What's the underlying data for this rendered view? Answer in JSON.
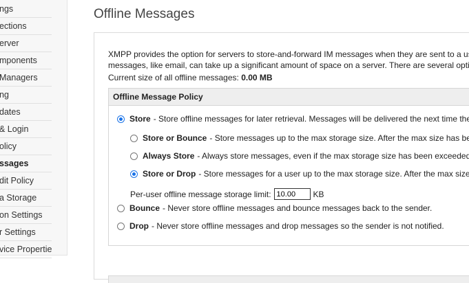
{
  "sidebar": {
    "items": [
      {
        "label": "ngs",
        "active": false
      },
      {
        "label": "ections",
        "active": false
      },
      {
        "label": "erver",
        "active": false
      },
      {
        "label": "mponents",
        "active": false
      },
      {
        "label": "Managers",
        "active": false
      },
      {
        "label": "ng",
        "active": false
      },
      {
        "label": "dates",
        "active": false
      },
      {
        "label": "& Login",
        "active": false
      },
      {
        "label": "olicy",
        "active": false
      },
      {
        "label": "ssages",
        "active": true
      },
      {
        "label": "dit Policy",
        "active": false
      },
      {
        "label": "a Storage",
        "active": false
      },
      {
        "label": "on Settings",
        "active": false
      },
      {
        "label": "r Settings",
        "active": false
      },
      {
        "label": "vice Properties",
        "active": false
      }
    ]
  },
  "main": {
    "title": "Offline Messages",
    "intro_line1": "XMPP provides the option for servers to store-and-forward IM messages when they are sent to a us",
    "intro_line2": "messages, like email, can take up a significant amount of space on a server. There are several opti",
    "current_size_label": "Current size of all offline messages:",
    "current_size_value": "0.00 MB",
    "policy": {
      "header": "Offline Message Policy",
      "store": {
        "label": "Store",
        "desc": "- Store offline messages for later retrieval. Messages will be delivered the next time the",
        "checked": true
      },
      "store_or_bounce": {
        "label": "Store or Bounce",
        "desc": "- Store messages up to the max storage size. After the max size has be",
        "checked": false
      },
      "always_store": {
        "label": "Always Store",
        "desc": "- Always store messages, even if the max storage size has been exceeded",
        "checked": false
      },
      "store_or_drop": {
        "label": "Store or Drop",
        "desc": "- Store messages for a user up to the max storage size. After the max size",
        "checked": true
      },
      "limit_label": "Per-user offline message storage limit:",
      "limit_value": "10.00",
      "limit_unit": "KB",
      "bounce": {
        "label": "Bounce",
        "desc": "- Never store offline messages and bounce messages back to the sender.",
        "checked": false
      },
      "drop": {
        "label": "Drop",
        "desc": "- Never store offline messages and drop messages so the sender is not notified.",
        "checked": false
      }
    }
  },
  "colors": {
    "accent": "#1a73e8",
    "header_bg": "#eeeeee",
    "sidebar_bg": "#f7f7f7"
  }
}
